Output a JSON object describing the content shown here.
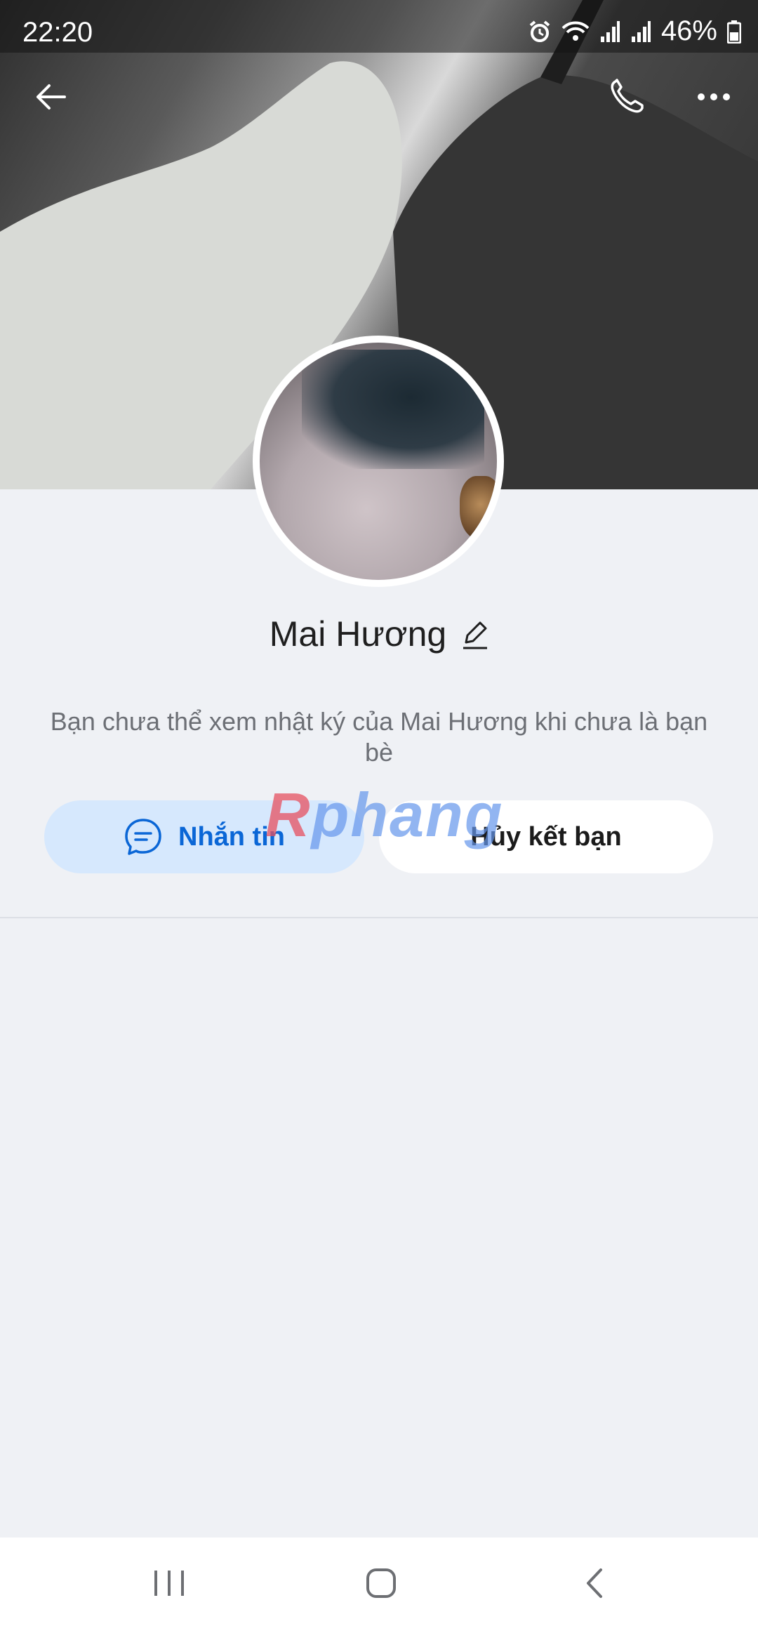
{
  "status_bar": {
    "time": "22:20",
    "battery": "46%",
    "icons": [
      "alarm-icon",
      "wifi-icon",
      "signal-icon",
      "signal-icon",
      "battery-icon"
    ]
  },
  "header": {
    "icons": [
      "back-arrow-icon",
      "phone-icon",
      "more-icon"
    ]
  },
  "profile": {
    "name": "Mai Hương",
    "notice": "Bạn chưa thể xem nhật ký của Mai Hương khi chưa là bạn bè"
  },
  "actions": {
    "message_label": "Nhắn tin",
    "unfriend_label": "Hủy kết bạn"
  },
  "watermark": "Rphang",
  "colors": {
    "background": "#eff1f5",
    "message_button_bg": "#d6e8fd",
    "message_button_text": "#0a66d6",
    "unfriend_button_bg": "#ffffff"
  }
}
